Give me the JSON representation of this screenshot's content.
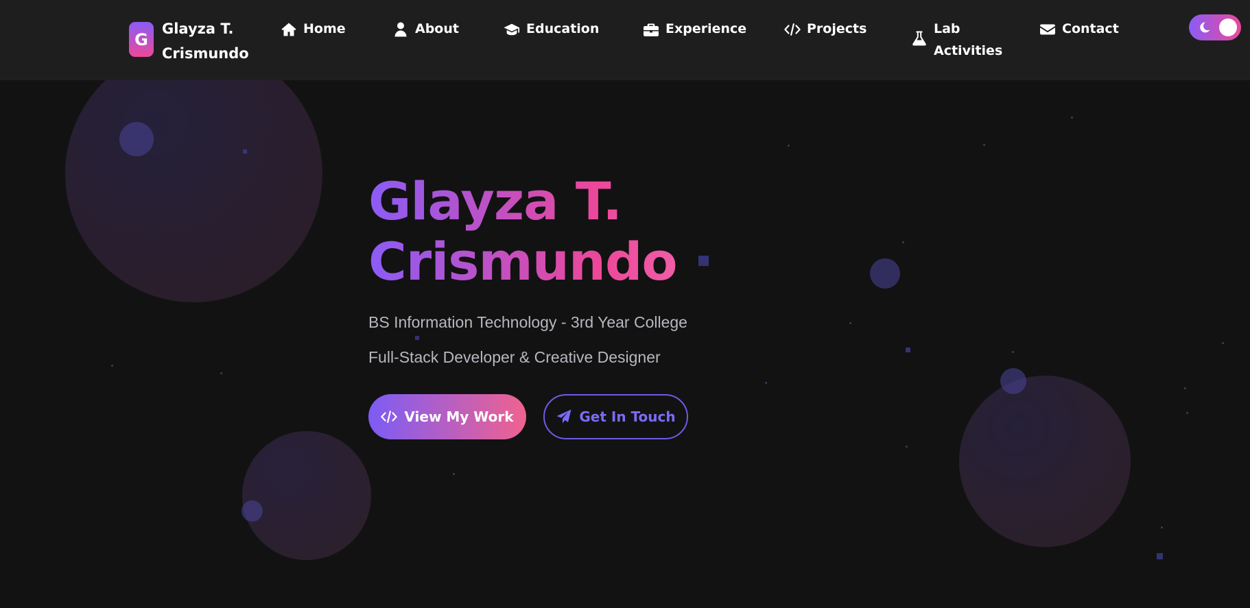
{
  "header": {
    "brand_initial": "G",
    "brand_name": "Glayza T. Crismundo",
    "nav": [
      {
        "label": "Home",
        "icon": "home-icon"
      },
      {
        "label": "About",
        "icon": "user-icon"
      },
      {
        "label": "Education",
        "icon": "graduation-cap-icon"
      },
      {
        "label": "Experience",
        "icon": "briefcase-icon"
      },
      {
        "label": "Projects",
        "icon": "code-icon"
      },
      {
        "label": "Lab Activities",
        "icon": "flask-icon"
      },
      {
        "label": "Contact",
        "icon": "envelope-icon"
      }
    ],
    "theme_toggle": {
      "mode": "dark",
      "icon": "moon-icon"
    }
  },
  "hero": {
    "title": "Glayza T. Crismundo",
    "subtitle_1": "BS Information Technology - 3rd Year College",
    "subtitle_2": "Full-Stack Developer & Creative Designer",
    "primary_button": {
      "label": "View My Work",
      "icon": "code-icon"
    },
    "secondary_button": {
      "label": "Get In Touch",
      "icon": "paper-plane-icon"
    }
  },
  "colors": {
    "accent_purple": "#8b5cf6",
    "accent_pink": "#ec4899",
    "background": "#121213",
    "navbar": "#1e1e1f"
  }
}
